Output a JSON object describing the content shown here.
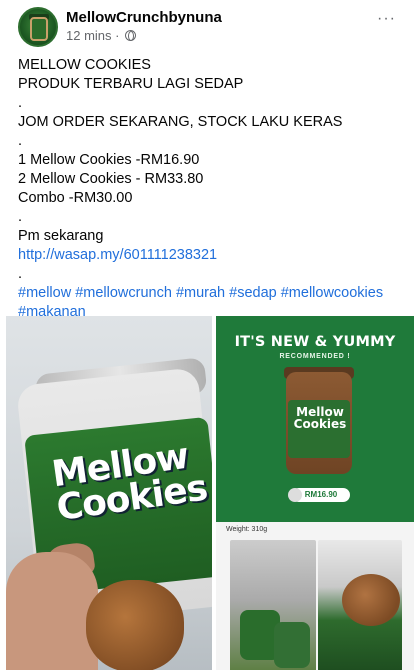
{
  "post": {
    "page_name": "MellowCrunchbynuna",
    "time": "12 mins ·",
    "more": "···",
    "lines": [
      "MELLOW COOKIES",
      "PRODUK TERBARU LAGI SEDAP",
      ".",
      "JOM ORDER SEKARANG, STOCK LAKU KERAS",
      ".",
      "1 Mellow Cookies -RM16.90",
      "2 Mellow Cookies - RM33.80",
      "Combo -RM30.00",
      ".",
      "Pm sekarang"
    ],
    "link": "http://wasap.my/601111238321",
    "dot_after_link": ".",
    "hashtags_line1": "#mellow #mellowcrunch #murah #sedap #mellowcookies",
    "hashtags_line2": "#makanan"
  },
  "photos": {
    "main_jar_text": "Mellow Cookies",
    "promo_title": "IT'S NEW & YUMMY",
    "promo_subtitle": "RECOMMENDED !",
    "promo_jar_text": "Mellow Cookies",
    "promo_price": "RM16.90",
    "weight_label": "Weight: 310g"
  },
  "colors": {
    "link": "#216fdb",
    "promo_bg": "#1f7a3a",
    "label_green": "#2c7a2f"
  }
}
